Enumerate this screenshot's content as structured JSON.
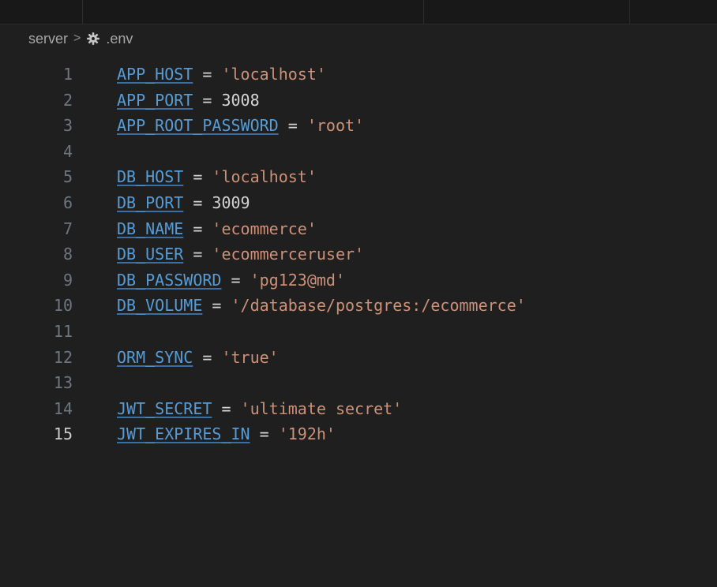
{
  "breadcrumb": {
    "folder": "server",
    "separator": ">",
    "file": ".env",
    "file_icon": "gear-icon"
  },
  "active_line": 15,
  "lines": [
    {
      "num": "1",
      "key": "APP_HOST",
      "op": " = ",
      "value": "'localhost'",
      "value_type": "string"
    },
    {
      "num": "2",
      "key": "APP_PORT",
      "op": " = ",
      "value": "3008",
      "value_type": "number"
    },
    {
      "num": "3",
      "key": "APP_ROOT_PASSWORD",
      "op": " = ",
      "value": "'root'",
      "value_type": "string"
    },
    {
      "num": "4",
      "key": "",
      "op": "",
      "value": "",
      "value_type": "empty"
    },
    {
      "num": "5",
      "key": "DB_HOST",
      "op": " = ",
      "value": "'localhost'",
      "value_type": "string"
    },
    {
      "num": "6",
      "key": "DB_PORT",
      "op": " = ",
      "value": "3009",
      "value_type": "number"
    },
    {
      "num": "7",
      "key": "DB_NAME",
      "op": " = ",
      "value": "'ecommerce'",
      "value_type": "string"
    },
    {
      "num": "8",
      "key": "DB_USER",
      "op": " = ",
      "value": "'ecommerceruser'",
      "value_type": "string"
    },
    {
      "num": "9",
      "key": "DB_PASSWORD",
      "op": " = ",
      "value": "'pg123@md'",
      "value_type": "string"
    },
    {
      "num": "10",
      "key": "DB_VOLUME",
      "op": " = ",
      "value": "'/database/postgres:/ecommerce'",
      "value_type": "string"
    },
    {
      "num": "11",
      "key": "",
      "op": "",
      "value": "",
      "value_type": "empty"
    },
    {
      "num": "12",
      "key": "ORM_SYNC",
      "op": " = ",
      "value": "'true'",
      "value_type": "string"
    },
    {
      "num": "13",
      "key": "",
      "op": "",
      "value": "",
      "value_type": "empty"
    },
    {
      "num": "14",
      "key": "JWT_SECRET",
      "op": " = ",
      "value": "'ultimate secret'",
      "value_type": "string"
    },
    {
      "num": "15",
      "key": "JWT_EXPIRES_IN",
      "op": " = ",
      "value": "'192h'",
      "value_type": "string"
    }
  ],
  "colors": {
    "background": "#1f1f1f",
    "key": "#569cd6",
    "string": "#ce9178",
    "number": "#d4d4d4",
    "line_number": "#6e7681",
    "line_number_active": "#cccccc"
  }
}
